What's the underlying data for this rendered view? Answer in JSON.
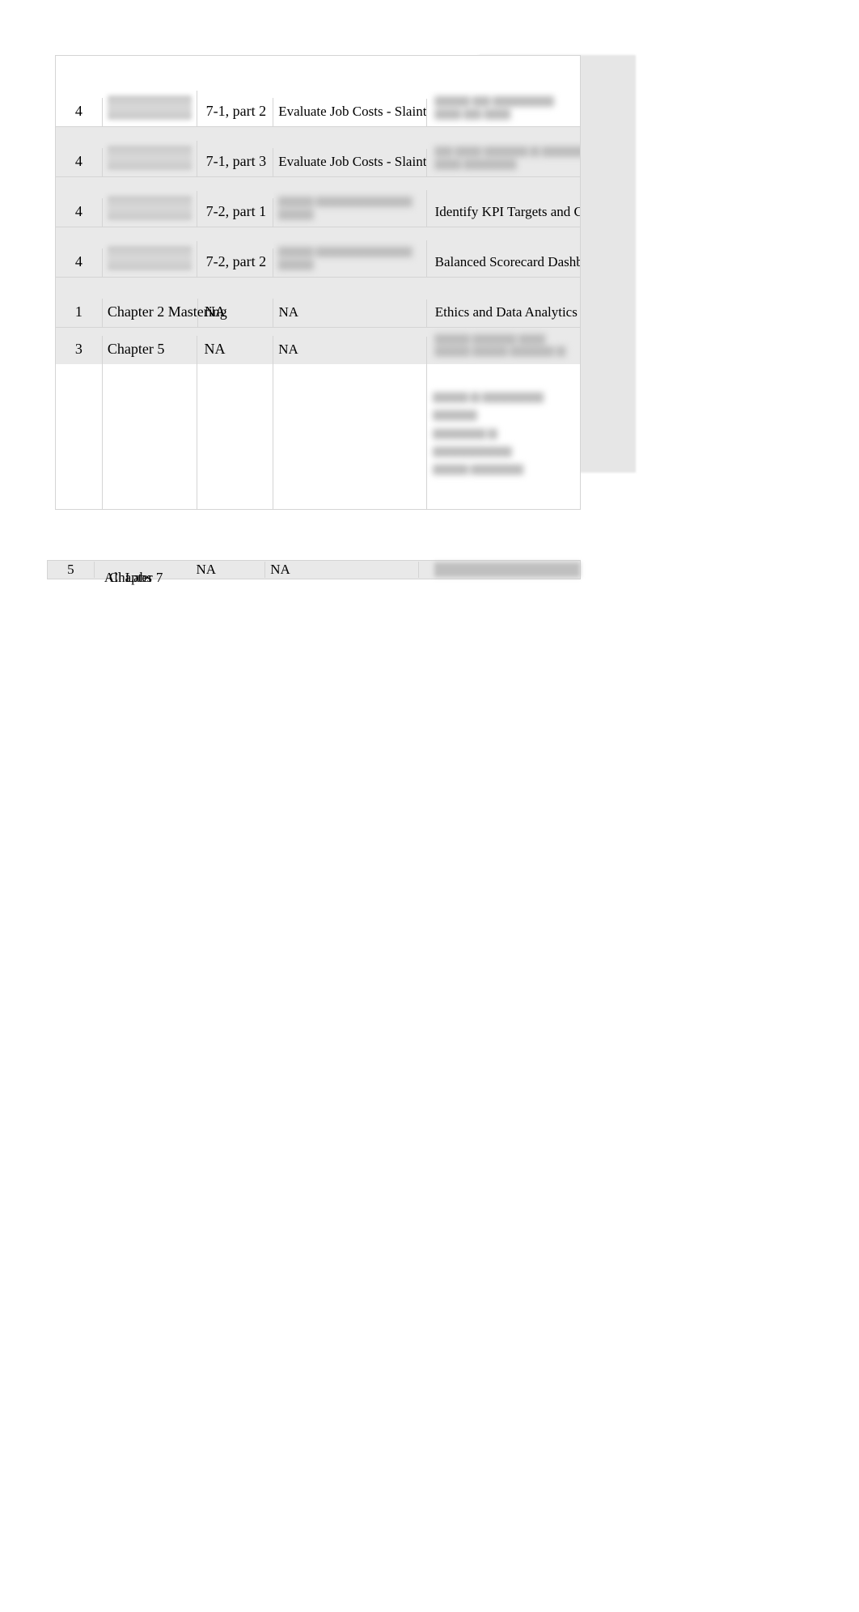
{
  "table": {
    "rows": [
      {
        "num": "4",
        "img": true,
        "col2": "7-1, part 2",
        "col3": "Evaluate Job Costs - Slainte",
        "col4_blur": true,
        "bg": "white",
        "h": "tall"
      },
      {
        "num": "4",
        "img": true,
        "col2": "7-1, part 3",
        "col3": "Evaluate Job Costs - Slainte",
        "col4_blur": true,
        "bg": "grey",
        "h": "med"
      },
      {
        "num": "4",
        "img": true,
        "col2": "7-2, part 1",
        "col3_blur": true,
        "col4": "Identify KPI Targets and Colors",
        "bg": "grey",
        "h": "med"
      },
      {
        "num": "4",
        "img": true,
        "col2": "7-2, part 2",
        "col3_blur": true,
        "col4": "Balanced Scorecard Dashboard",
        "bg": "grey",
        "h": "med"
      },
      {
        "num": "1",
        "col1": "Chapter 2 Mastering",
        "col2": "NA",
        "col3": "NA",
        "col4": "Ethics and Data Analytics",
        "bg": "grey",
        "h": "med"
      },
      {
        "num": "3",
        "col1": "Chapter 5",
        "col2": "NA",
        "col3": "NA",
        "col4_blur": true,
        "bg": "grey",
        "h": "short"
      }
    ]
  },
  "footer_row": {
    "num": "5",
    "col1a": "Chapter 7",
    "col1b": "All Labs",
    "col2": "NA",
    "col3": "NA"
  }
}
